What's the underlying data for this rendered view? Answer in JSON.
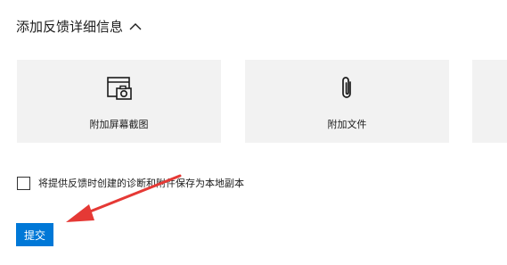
{
  "section": {
    "title": "添加反馈详细信息"
  },
  "cards": [
    {
      "label": "附加屏幕截图",
      "icon": "screenshot-icon"
    },
    {
      "label": "附加文件",
      "icon": "paperclip-icon"
    },
    {
      "label": "",
      "icon": ""
    }
  ],
  "checkbox": {
    "label": "将提供反馈时创建的诊断和附件保存为本地副本",
    "checked": false
  },
  "submit": {
    "label": "提交"
  },
  "colors": {
    "accent": "#0078d7",
    "card_bg": "#f2f2f2",
    "annotation_arrow": "#e53935"
  }
}
